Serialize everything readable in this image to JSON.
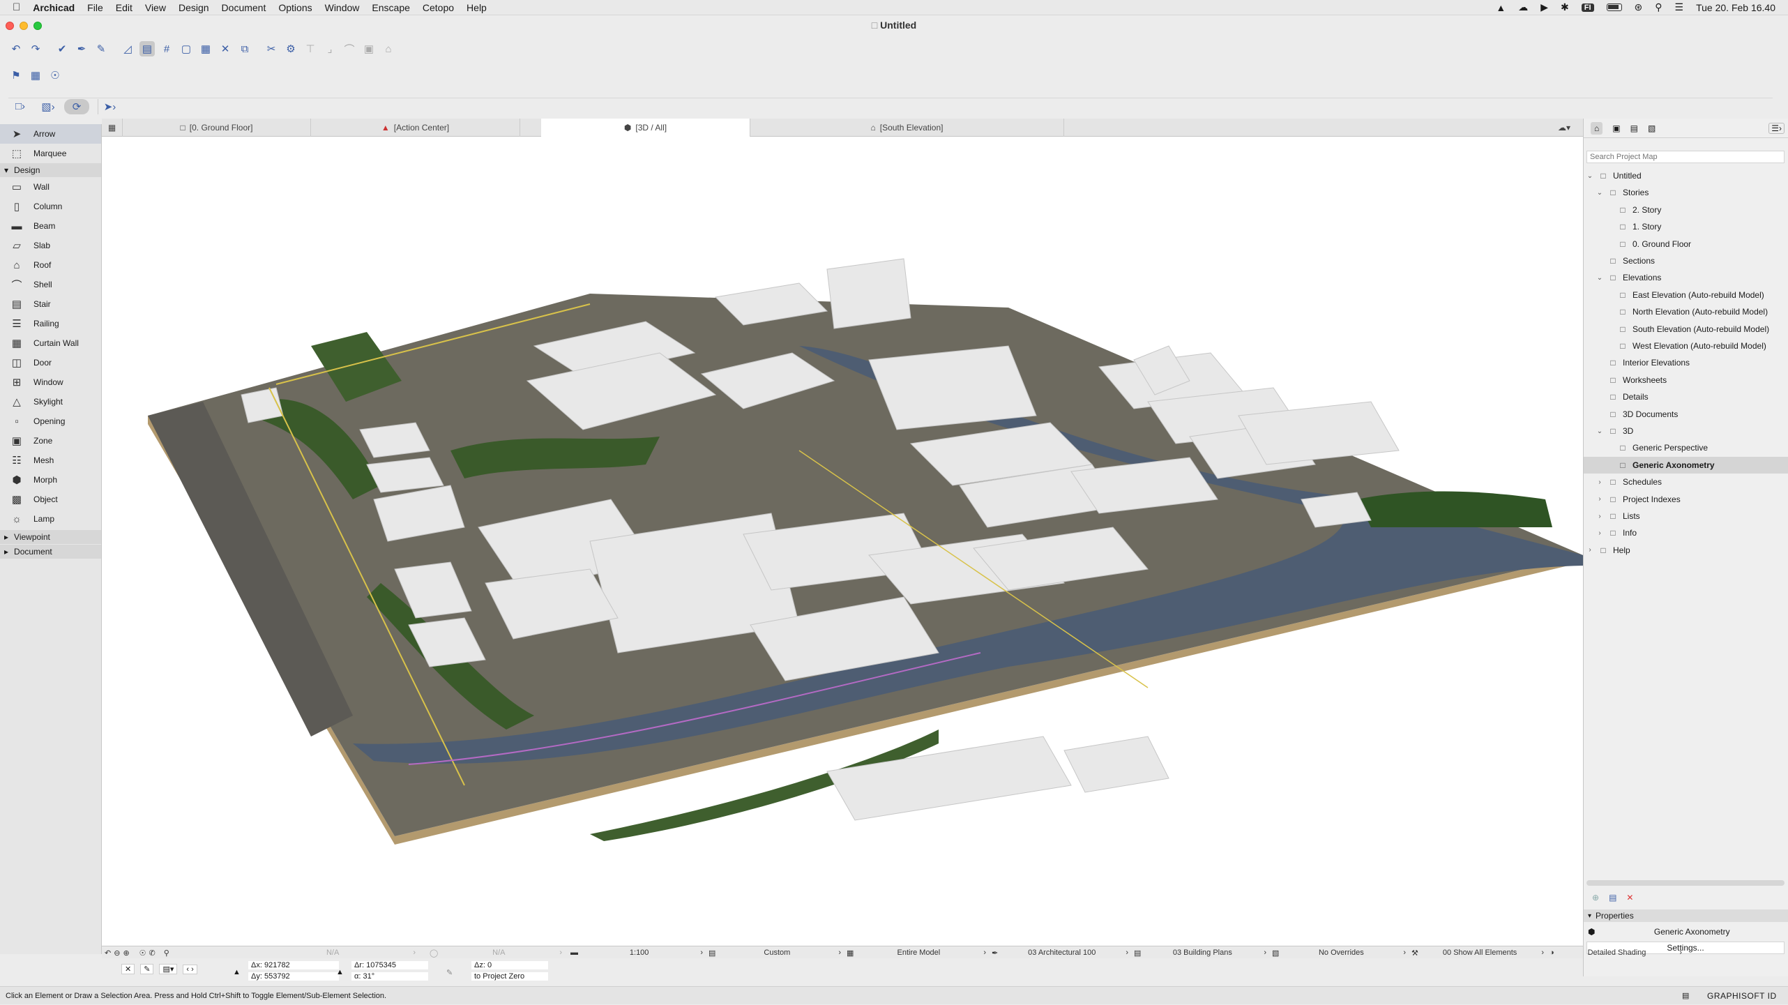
{
  "menubar": {
    "app": "Archicad",
    "items": [
      "File",
      "Edit",
      "View",
      "Design",
      "Document",
      "Options",
      "Window",
      "Enscape",
      "Cetopo",
      "Help"
    ],
    "clock": "Tue 20. Feb 16.40",
    "input_lang": "FI"
  },
  "window": {
    "title": "Untitled"
  },
  "toolbox": {
    "top_tools": [
      {
        "label": "Arrow",
        "icon": "arrow-icon"
      },
      {
        "label": "Marquee",
        "icon": "marquee-icon"
      }
    ],
    "design_group": "Design",
    "design_tools": [
      {
        "label": "Wall",
        "icon": "wall-icon"
      },
      {
        "label": "Column",
        "icon": "column-icon"
      },
      {
        "label": "Beam",
        "icon": "beam-icon"
      },
      {
        "label": "Slab",
        "icon": "slab-icon"
      },
      {
        "label": "Roof",
        "icon": "roof-icon"
      },
      {
        "label": "Shell",
        "icon": "shell-icon"
      },
      {
        "label": "Stair",
        "icon": "stair-icon"
      },
      {
        "label": "Railing",
        "icon": "railing-icon"
      },
      {
        "label": "Curtain Wall",
        "icon": "curtain-wall-icon"
      },
      {
        "label": "Door",
        "icon": "door-icon"
      },
      {
        "label": "Window",
        "icon": "window-icon"
      },
      {
        "label": "Skylight",
        "icon": "skylight-icon"
      },
      {
        "label": "Opening",
        "icon": "opening-icon"
      },
      {
        "label": "Zone",
        "icon": "zone-icon"
      },
      {
        "label": "Mesh",
        "icon": "mesh-icon"
      },
      {
        "label": "Morph",
        "icon": "morph-icon"
      },
      {
        "label": "Object",
        "icon": "object-icon"
      },
      {
        "label": "Lamp",
        "icon": "lamp-icon"
      }
    ],
    "collapsed_groups": [
      "Viewpoint",
      "Document"
    ]
  },
  "view_tabs": [
    {
      "label": "[0. Ground Floor]",
      "icon": "floor-plan-icon"
    },
    {
      "label": "[Action Center]",
      "icon": "action-center-icon"
    },
    {
      "label": "[3D / All]",
      "icon": "3d-icon",
      "active": true
    },
    {
      "label": "[South Elevation]",
      "icon": "elevation-icon"
    }
  ],
  "navigator": {
    "search_placeholder": "Search Project Map",
    "items": [
      {
        "label": "Untitled",
        "level": 0,
        "twisty": "open"
      },
      {
        "label": "Stories",
        "level": 1,
        "twisty": "open"
      },
      {
        "label": "2. Story",
        "level": 2,
        "twisty": ""
      },
      {
        "label": "1. Story",
        "level": 2,
        "twisty": ""
      },
      {
        "label": "0. Ground Floor",
        "level": 2,
        "twisty": ""
      },
      {
        "label": "Sections",
        "level": 1,
        "twisty": ""
      },
      {
        "label": "Elevations",
        "level": 1,
        "twisty": "open"
      },
      {
        "label": "East Elevation (Auto-rebuild Model)",
        "level": 2,
        "twisty": ""
      },
      {
        "label": "North Elevation (Auto-rebuild Model)",
        "level": 2,
        "twisty": ""
      },
      {
        "label": "South Elevation (Auto-rebuild Model)",
        "level": 2,
        "twisty": ""
      },
      {
        "label": "West Elevation (Auto-rebuild Model)",
        "level": 2,
        "twisty": ""
      },
      {
        "label": "Interior Elevations",
        "level": 1,
        "twisty": ""
      },
      {
        "label": "Worksheets",
        "level": 1,
        "twisty": ""
      },
      {
        "label": "Details",
        "level": 1,
        "twisty": ""
      },
      {
        "label": "3D Documents",
        "level": 1,
        "twisty": ""
      },
      {
        "label": "3D",
        "level": 1,
        "twisty": "open"
      },
      {
        "label": "Generic Perspective",
        "level": 2,
        "twisty": ""
      },
      {
        "label": "Generic Axonometry",
        "level": 2,
        "twisty": "",
        "selected": true
      },
      {
        "label": "Schedules",
        "level": 1,
        "twisty": "closed"
      },
      {
        "label": "Project Indexes",
        "level": 1,
        "twisty": "closed"
      },
      {
        "label": "Lists",
        "level": 1,
        "twisty": "closed"
      },
      {
        "label": "Info",
        "level": 1,
        "twisty": "closed"
      },
      {
        "label": "Help",
        "level": 0,
        "twisty": "closed"
      }
    ],
    "properties_header": "Properties",
    "properties_name": "Generic Axonometry",
    "settings_button": "Settings..."
  },
  "quick_options": {
    "scale": "1:100",
    "structure": "Custom",
    "model_view": "Entire Model",
    "pen_set": "03 Architectural 100",
    "layer_combo": "03 Building Plans",
    "graphic_override": "No Overrides",
    "renovation": "00 Show All Elements",
    "shading": "Detailed Shading",
    "na1": "N/A",
    "na2": "N/A"
  },
  "coords": {
    "dx": "921782",
    "dy": "553792",
    "dr": "1075345",
    "angle": "31°",
    "dz": "0",
    "ref": "to Project Zero"
  },
  "status": {
    "hint": "Click an Element or Draw a Selection Area. Press and Hold Ctrl+Shift to Toggle Element/Sub-Element Selection.",
    "brand": "GRAPHISOFT ID"
  }
}
